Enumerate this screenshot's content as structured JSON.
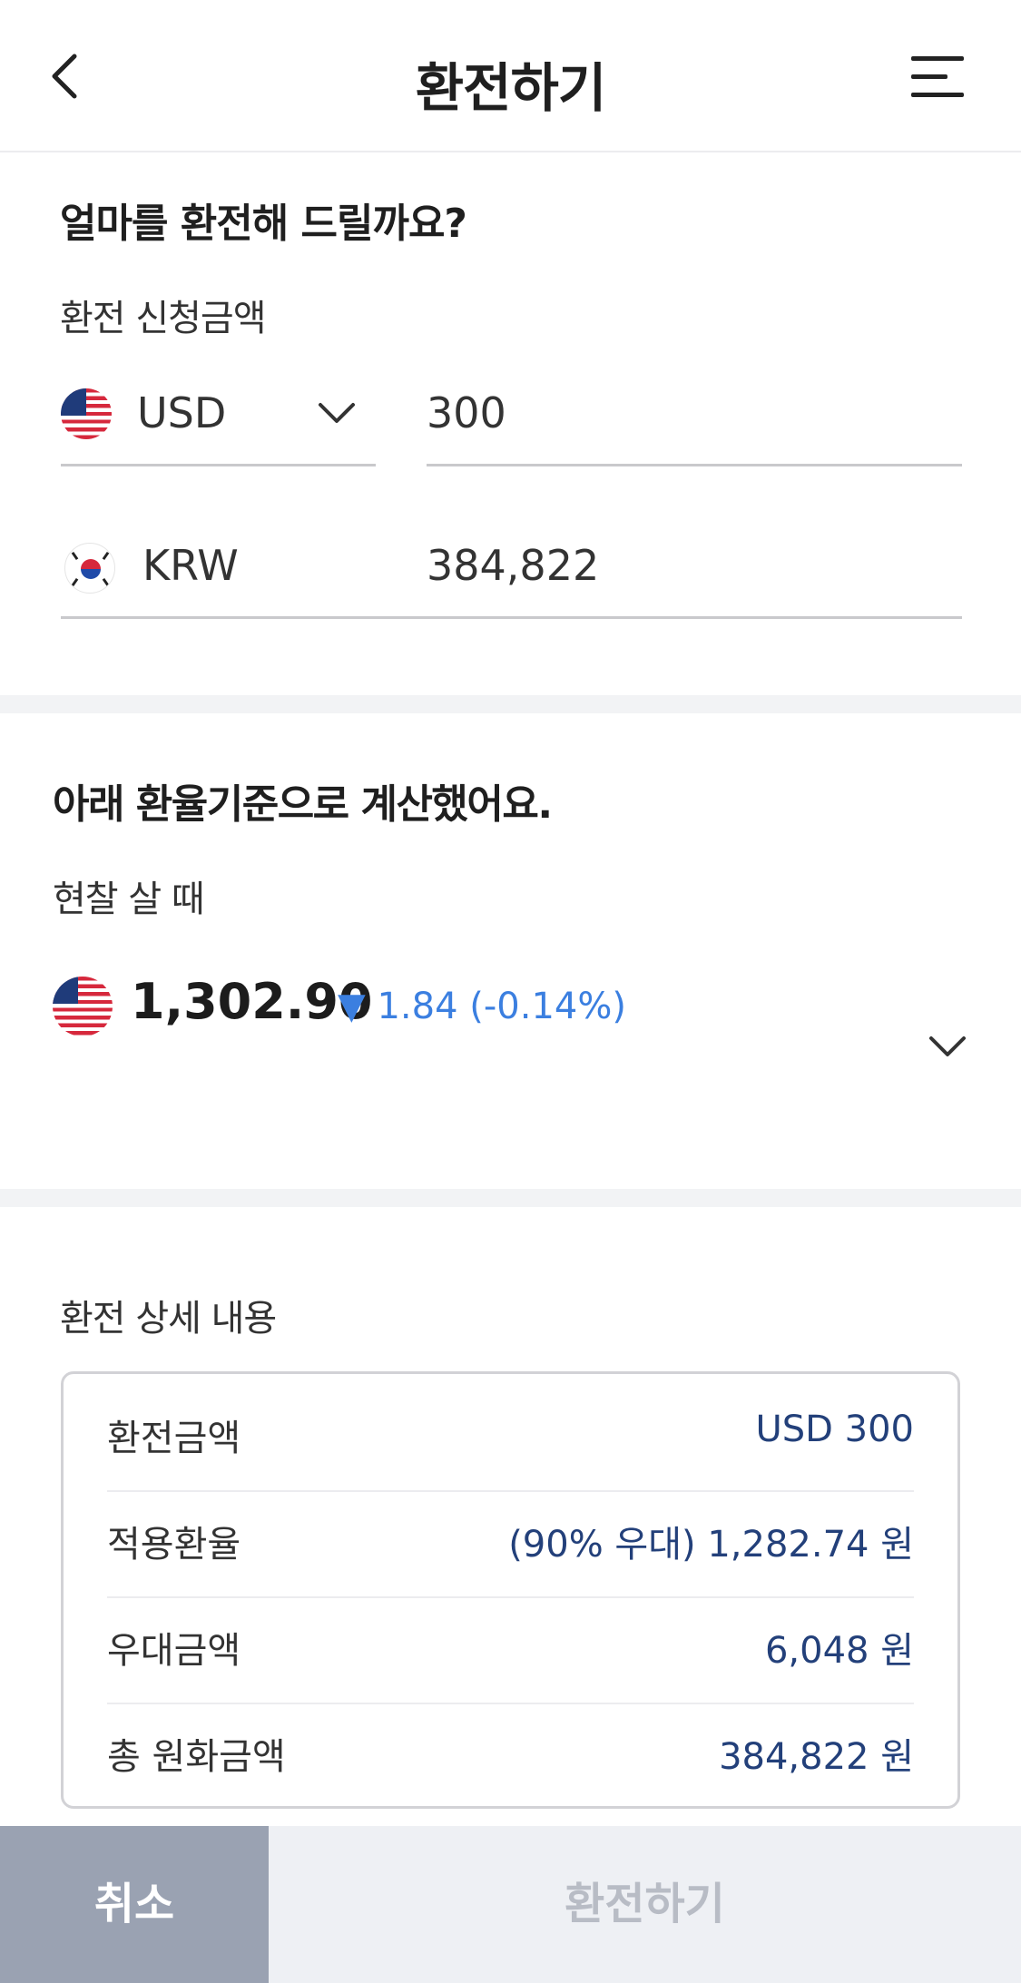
{
  "header": {
    "title": "환전하기",
    "back_icon": "chevron-left-icon",
    "menu_icon": "hamburger-menu-icon"
  },
  "amount_section": {
    "question": "얼마를 환전해 드릴까요?",
    "label": "환전 신청금액",
    "from_currency": {
      "code": "USD",
      "amount": "300",
      "flag": "us-flag-icon"
    },
    "to_currency": {
      "code": "KRW",
      "amount": "384,822",
      "flag": "kr-flag-icon"
    }
  },
  "rate_section": {
    "title": "아래 환율기준으로 계산했어요.",
    "rate_type": "현찰 살 때",
    "rate": "1,302.90",
    "change": "▼ 1.84 (-0.14%)",
    "change_color": "#3b7fe0"
  },
  "detail_section": {
    "title": "환전 상세 내용",
    "rows": [
      {
        "label": "환전금액",
        "value": "USD 300"
      },
      {
        "label": "적용환율",
        "value": "(90% 우대) 1,282.74 원"
      },
      {
        "label": "우대금액",
        "value": "6,048 원"
      },
      {
        "label": "총 원화금액",
        "value": "384,822 원"
      }
    ]
  },
  "footer": {
    "cancel_label": "취소",
    "exchange_label": "환전하기"
  }
}
